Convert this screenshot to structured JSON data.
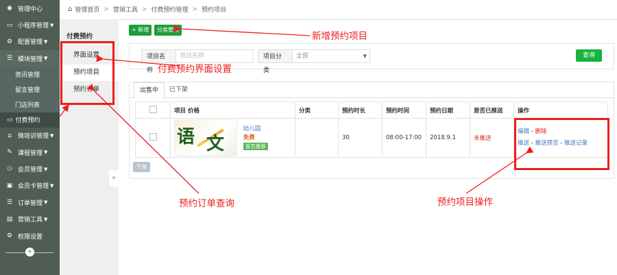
{
  "sidebar": {
    "items": [
      {
        "label": "管理中心",
        "icon": "dashboard-icon",
        "glyph": "◉",
        "has_caret": false
      },
      {
        "label": "小程序管理",
        "icon": "monitor-icon",
        "glyph": "▭",
        "has_caret": true
      },
      {
        "label": "配置管理",
        "icon": "gears-icon",
        "glyph": "⚙",
        "has_caret": true
      },
      {
        "label": "模块管理",
        "icon": "list-icon",
        "glyph": "☰",
        "has_caret": true
      }
    ],
    "subitems": [
      "资讯管理",
      "留言管理",
      "门店列表"
    ],
    "current_subitem": "付费预约",
    "items_after": [
      {
        "label": "微培训管理",
        "icon": "home-icon",
        "glyph": "⌂",
        "has_caret": true
      },
      {
        "label": "课程管理",
        "icon": "edit-icon",
        "glyph": "✎",
        "has_caret": true
      },
      {
        "label": "会员管理",
        "icon": "user-icon",
        "glyph": "⚇",
        "has_caret": true
      },
      {
        "label": "会员卡管理",
        "icon": "id-card-icon",
        "glyph": "▣",
        "has_caret": true
      },
      {
        "label": "订单管理",
        "icon": "list-icon",
        "glyph": "☰",
        "has_caret": true
      },
      {
        "label": "营销工具",
        "icon": "briefcase-icon",
        "glyph": "▤",
        "has_caret": true
      },
      {
        "label": "权限设置",
        "icon": "gear-icon",
        "glyph": "⚙",
        "has_caret": false
      }
    ]
  },
  "breadcrumb": [
    "管理首页",
    "营销工具",
    "付费预约管理",
    "预约项目"
  ],
  "submenu": {
    "title": "付费预约",
    "items": [
      "界面设置",
      "预约项目",
      "预约订单"
    ],
    "active_index": 1
  },
  "toolbar": {
    "add_label": "+ 新增",
    "category_label": "分类管理"
  },
  "search": {
    "name_label": "项目名称",
    "name_placeholder": "项目名称",
    "category_label": "项目分类",
    "category_value": "全部",
    "query_label": "查询"
  },
  "tabs": [
    "出售中",
    "已下架"
  ],
  "table": {
    "headers": [
      "项目 价格",
      "分类",
      "预约时长",
      "预约时间",
      "预约日期",
      "是否已推送",
      "操作"
    ],
    "rows": [
      {
        "thumb_chars": [
          "语",
          "文"
        ],
        "name": "幼儿园",
        "price": "免费",
        "badge": "首页推荐",
        "category": "",
        "duration": "30",
        "time": "08:00-17:00",
        "date": "2018.9.1",
        "pushed": "未推送",
        "ops_edit": "编辑",
        "ops_delete": "删除",
        "ops_push": "推送",
        "ops_preview": "推送预览",
        "ops_records": "推送记录"
      }
    ]
  },
  "offline_label": "下架",
  "annotations": {
    "add": "新增预约项目",
    "ui": "付费预约界面设置",
    "order": "预约订单查询",
    "ops": "预约项目操作"
  },
  "colors": {
    "annotation": "#ee1c1c",
    "sidebar": "#4f5d55",
    "accent": "#16b33d",
    "link": "#3c7ac4"
  }
}
